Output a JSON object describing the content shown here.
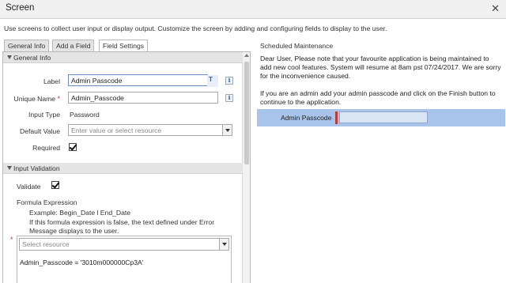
{
  "window": {
    "title": "Screen",
    "close_glyph": "✕"
  },
  "description": "Use screens to collect user input or display output. Customize the screen by adding and configuring fields to display to the user.",
  "tabs": [
    {
      "label": "General Info"
    },
    {
      "label": "Add a Field"
    },
    {
      "label": "Field Settings"
    }
  ],
  "general_info": {
    "header": "General Info",
    "label_label": "Label",
    "label_value": "Admin Passcode",
    "unique_name_label": "Unique Name",
    "unique_name_value": "Admin_Passcode",
    "input_type_label": "Input Type",
    "input_type_value": "Password",
    "default_value_label": "Default Value",
    "default_value_placeholder": "Enter value or select resource",
    "required_label": "Required",
    "required_checked": true,
    "required_star": "*",
    "info_glyph": "i",
    "resource_glyph": "T"
  },
  "input_validation": {
    "header": "Input Validation",
    "validate_label": "Validate",
    "validate_checked": true,
    "formula_expression_label": "Formula Expression",
    "example_text": "Example: Begin_Date l End_Date",
    "help_line1": "If this formula expression is false, the text defined under Error",
    "help_line2": "Message displays to the user.",
    "select_placeholder": "Select resource",
    "required_star": "*",
    "formula_value": "Admin_Passcode = '3010m000000Cp3A'"
  },
  "preview": {
    "title": "Scheduled Maintenance",
    "message1": "Dear User, Please note that your favourite application is being maintained to add new cool features. System will resume at 8am pst 07/24/2017. We are sorry for the inconvenience caused.",
    "message2": "If you are an admin add your admin passcode and click on the Finish button to continue to the application.",
    "field_label": "Admin Passcode",
    "field_value": ""
  },
  "colors": {
    "required_red": "#c23934",
    "highlight_blue": "#a9c4ea",
    "info_blue": "#2f5fa8"
  }
}
